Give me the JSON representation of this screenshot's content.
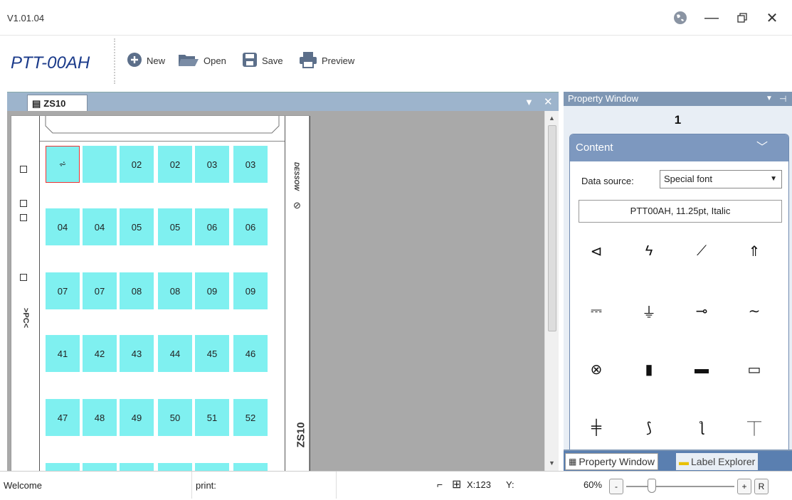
{
  "titlebar": {
    "version": "V1.01.04"
  },
  "toolbar": {
    "app_title": "PTT-00AH",
    "new_label": "New",
    "open_label": "Open",
    "save_label": "Save",
    "preview_label": "Preview"
  },
  "document": {
    "tab_label": "ZS10",
    "rows": [
      [
        "⩫",
        "",
        "02",
        "02",
        "03",
        "03"
      ],
      [
        "04",
        "04",
        "05",
        "05",
        "06",
        "06"
      ],
      [
        "07",
        "07",
        "08",
        "08",
        "09",
        "09"
      ],
      [
        "41",
        "42",
        "43",
        "44",
        "45",
        "46"
      ],
      [
        "47",
        "48",
        "49",
        "50",
        "51",
        "52"
      ]
    ],
    "left_strip_text": ">PC<",
    "right_strip_logo_text": "DESSOW",
    "right_strip_text": "ZS10"
  },
  "property": {
    "header": "Property Window",
    "label_number": "1",
    "group_title": "Content",
    "data_source_label": "Data source:",
    "data_source_value": "Special font",
    "font_display": "PTT00AH, 11.25pt, Italic",
    "symbols": [
      "speaker-icon",
      "lightning-icon",
      "probe-icon",
      "ground-arrow-icon",
      "dc-line-icon",
      "chassis-icon",
      "connector-icon",
      "ac-wave-icon",
      "lamp-icon",
      "fuse-icon",
      "plug-icon",
      "resistor-icon",
      "crossing-icon",
      "switch-open-icon",
      "switch-closed-icon",
      "antenna-icon"
    ],
    "tab_property": "Property Window",
    "tab_explorer": "Label Explorer"
  },
  "statusbar": {
    "welcome": "Welcome",
    "print": "print:",
    "x": "X:123",
    "y": "Y:",
    "zoom": "60%",
    "zoom_minus": "-",
    "zoom_plus": "+",
    "reset": "R"
  },
  "colors": {
    "accent": "#1a3a8a",
    "cell": "#7ff0f0",
    "tabbar": "#9db4cc",
    "group": "#7d98bf"
  }
}
